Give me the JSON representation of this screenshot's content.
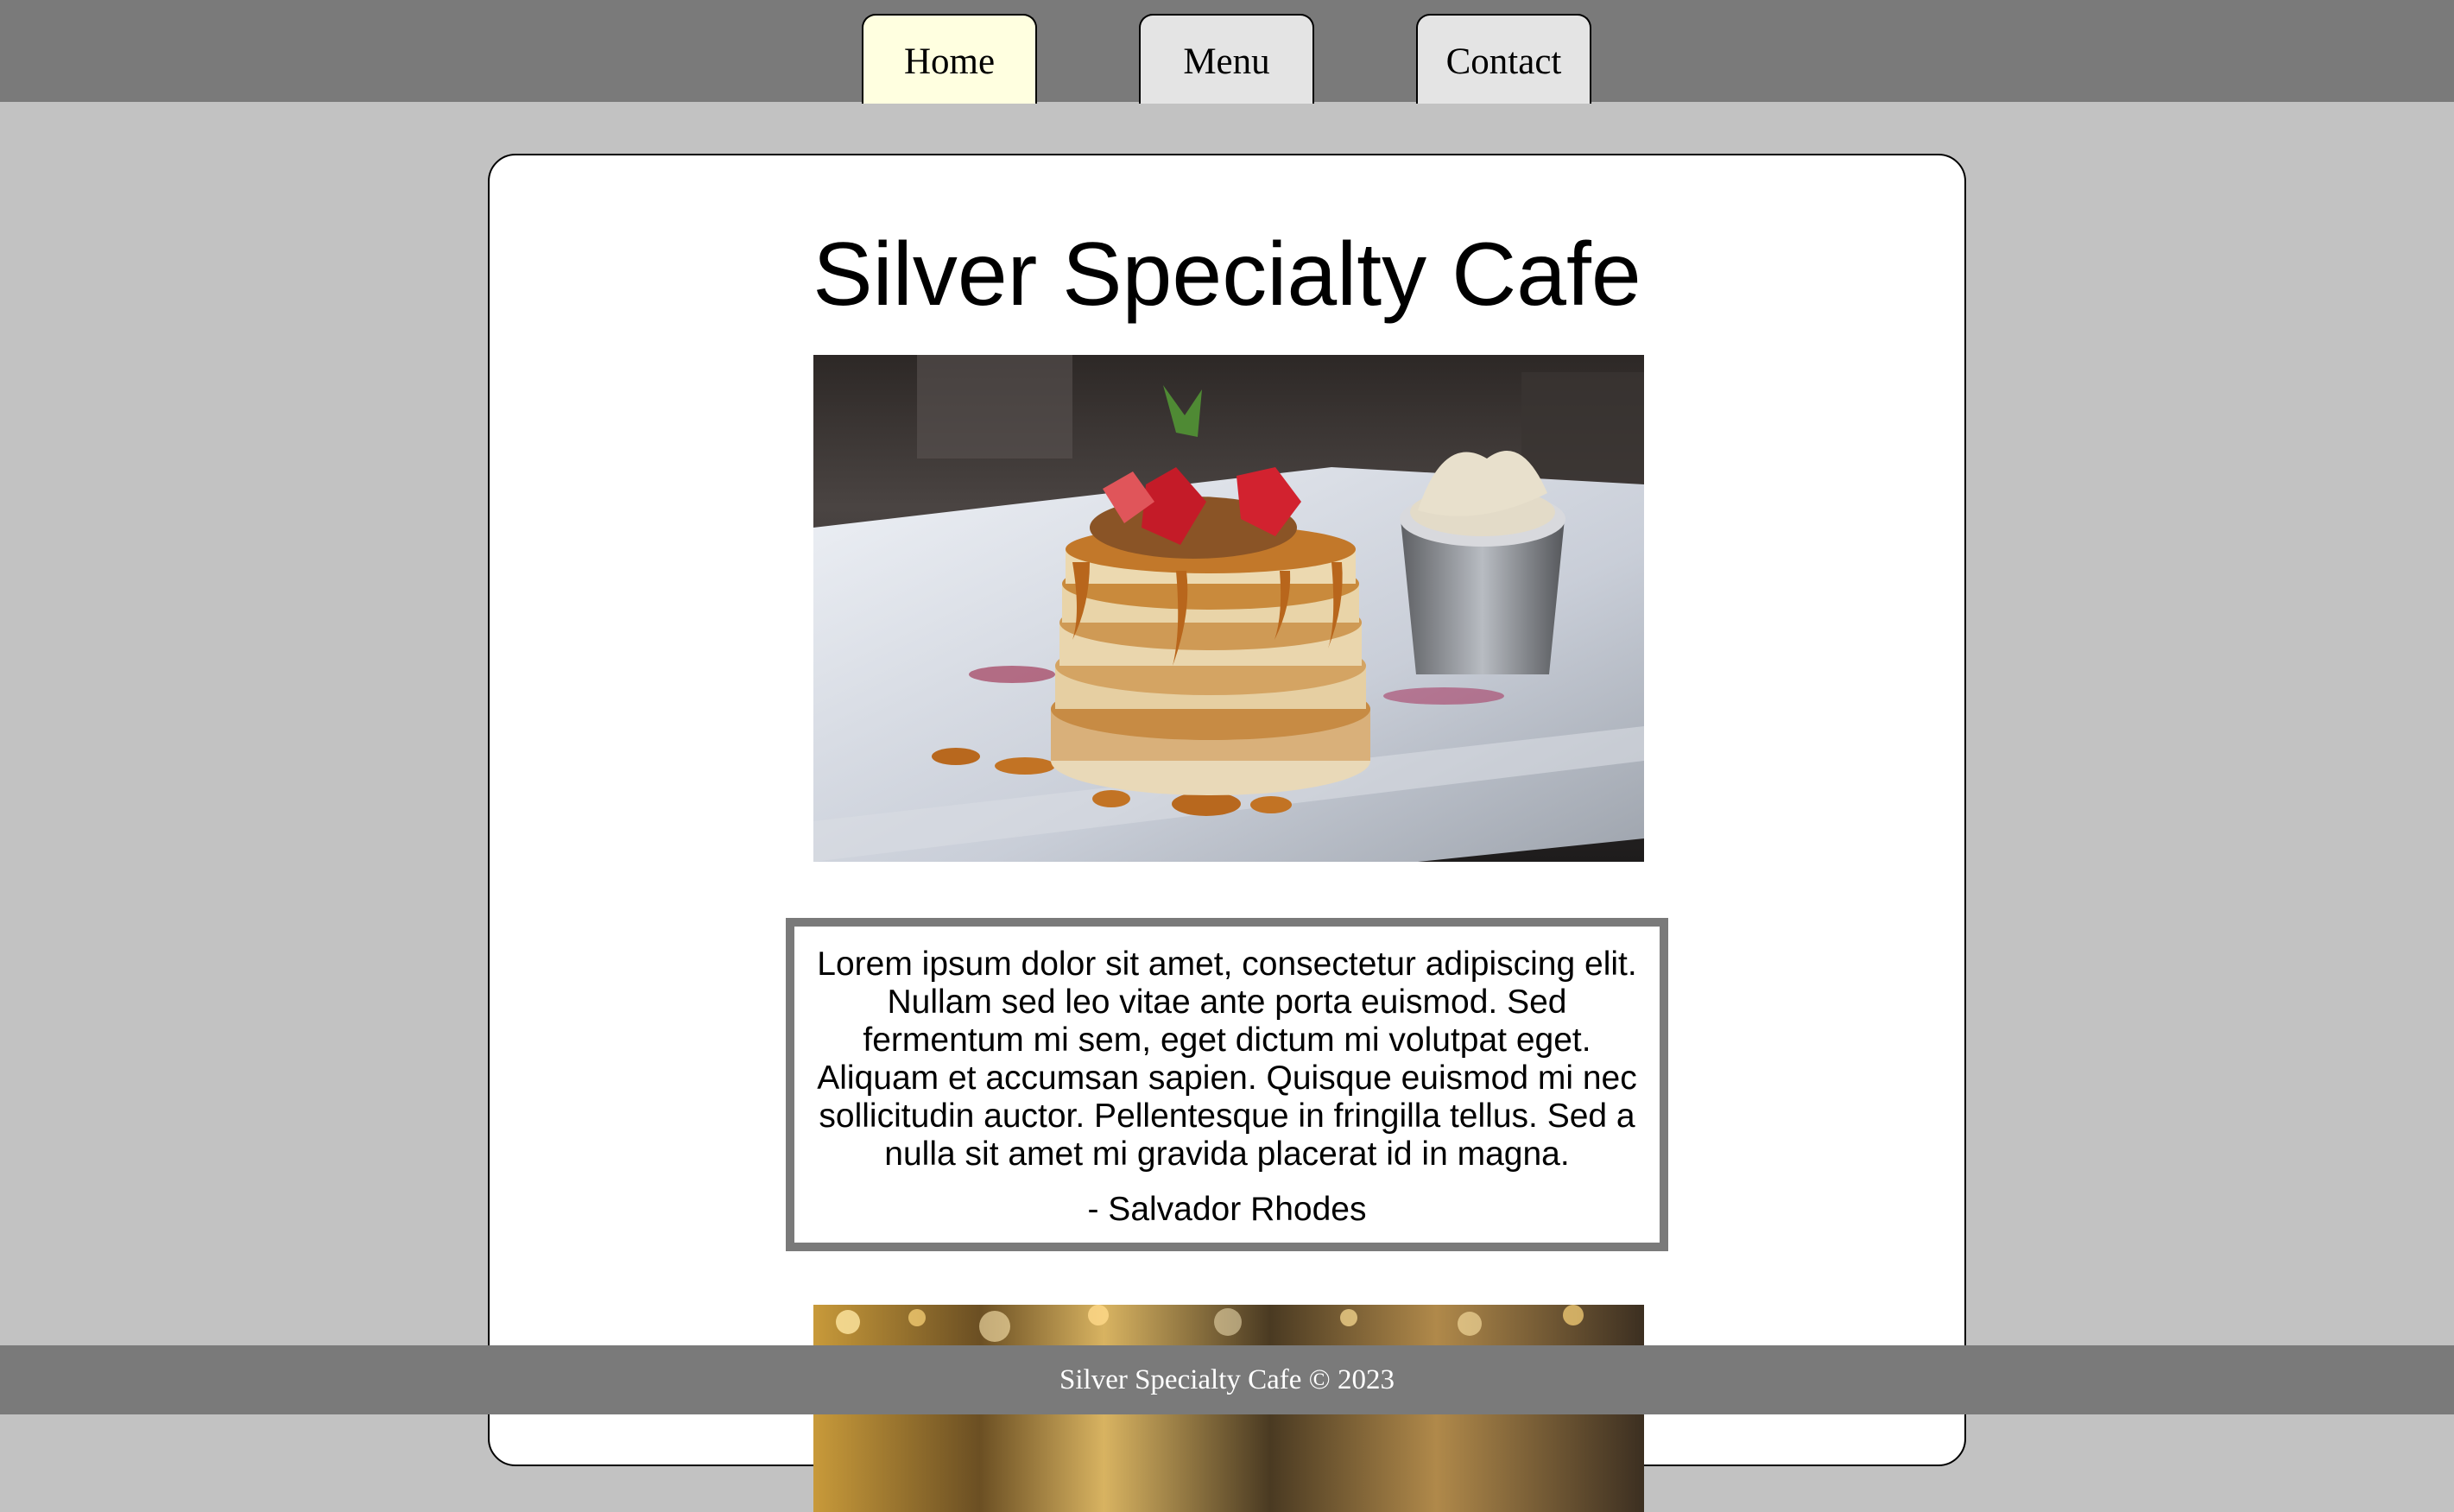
{
  "nav": {
    "tabs": [
      {
        "label": "Home",
        "active": true
      },
      {
        "label": "Menu",
        "active": false
      },
      {
        "label": "Contact",
        "active": false
      }
    ]
  },
  "main": {
    "title": "Silver Specialty Cafe",
    "quote": {
      "text": "Lorem ipsum dolor sit amet, consectetur adipiscing elit. Nullam sed leo vitae ante porta euismod. Sed fermentum mi sem, eget dictum mi volutpat eget. Aliquam et accumsan sapien. Quisque euismod mi nec sollicitudin auctor. Pellentesque in fringilla tellus. Sed a nulla sit amet mi gravida placerat id in magna.",
      "author": "- Salvador Rhodes"
    }
  },
  "footer": {
    "text": "Silver Specialty Cafe © 2023"
  },
  "colors": {
    "background": "#c2c2c2",
    "bar": "#7a7a7a",
    "active_tab": "#ffffe0",
    "inactive_tab": "#e4e4e4"
  }
}
